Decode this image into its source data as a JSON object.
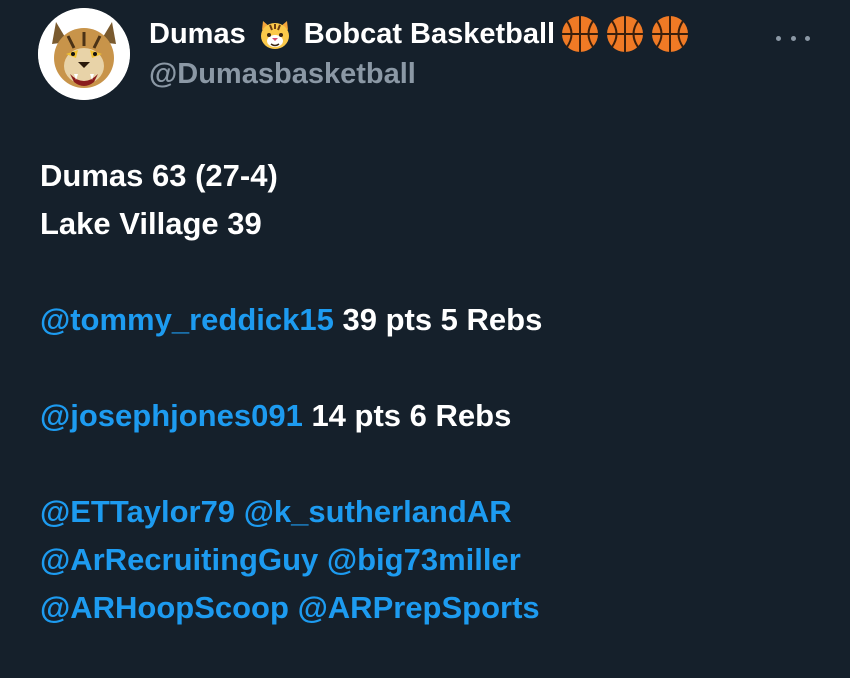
{
  "author": {
    "name_part1": "Dumas",
    "name_part2": "Bobcat Basketball",
    "tiger_emoji": "tiger-face-emoji",
    "ball_emoji_count": 3,
    "handle": "@Dumasbasketball",
    "avatar": "bobcat-logo"
  },
  "more_icon": "more-options-icon",
  "colors": {
    "background": "#15202b",
    "text": "#ffffff",
    "muted": "#8b98a5",
    "mention": "#1d9bf0"
  },
  "tweet": {
    "score_line1": "Dumas 63 (27-4)",
    "score_line2": "Lake Village 39",
    "player1_mention": "@tommy_reddick15",
    "player1_stats": " 39 pts 5 Rebs",
    "player2_mention": "@josephjones091",
    "player2_stats": " 14 pts 6 Rebs",
    "tags": [
      "@ETTaylor79",
      "@k_sutherlandAR",
      "@ArRecruitingGuy",
      "@big73miller",
      "@ARHoopScoop",
      "@ARPrepSports"
    ]
  }
}
